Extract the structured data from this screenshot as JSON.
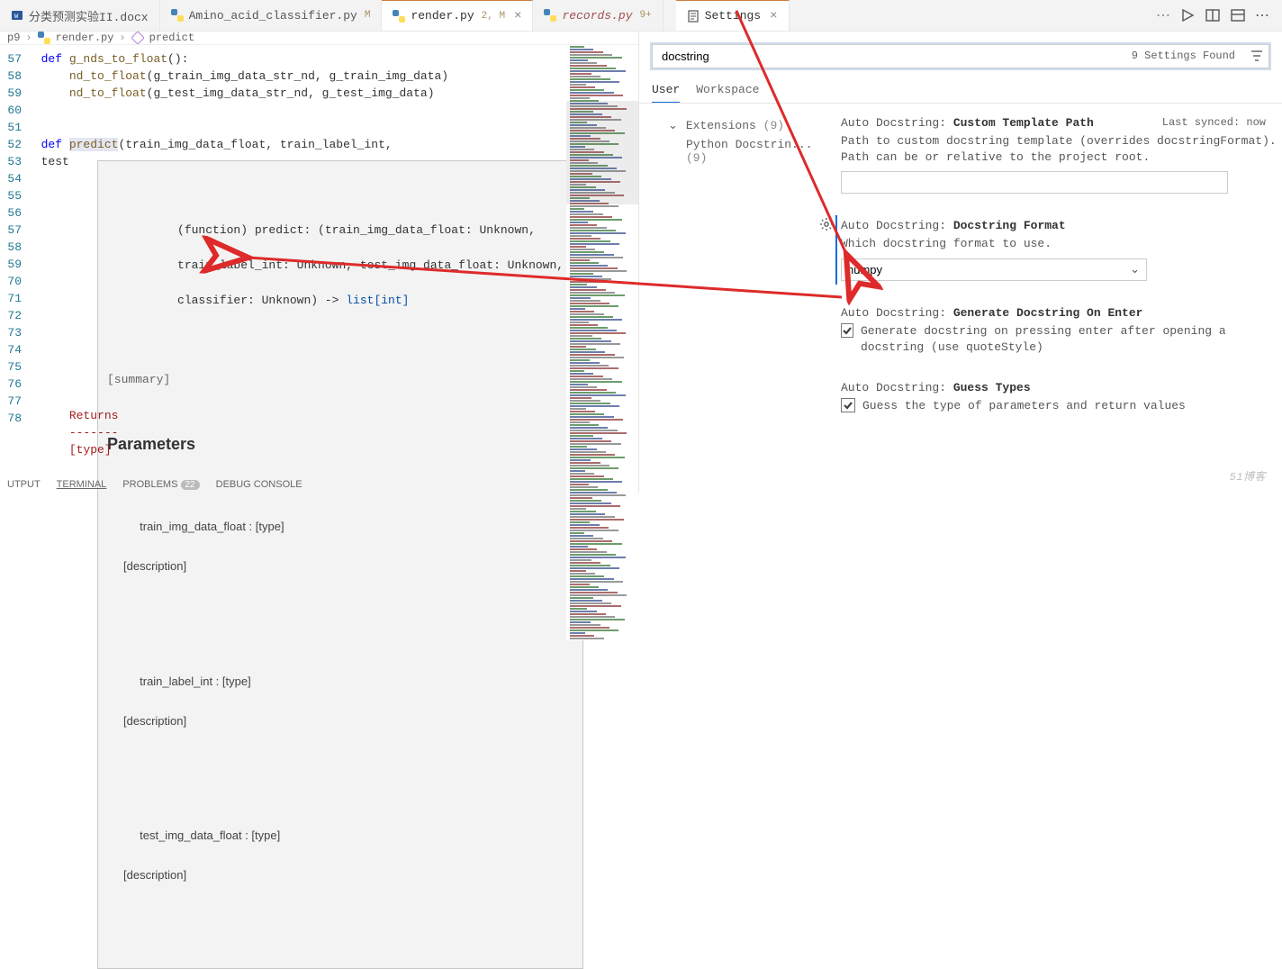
{
  "tabs": {
    "t0": "分类预测实验II.docx",
    "t1": "Amino_acid_classifier.py",
    "t1_badge": "M",
    "t2": "render.py",
    "t2_badge": "2, M",
    "t3": "records.py",
    "t3_badge": "9+",
    "t4": "Settings"
  },
  "breadcrumb": {
    "p1": "p9",
    "p2": "render.py",
    "p3": "predict"
  },
  "gutter": [
    "57",
    "58",
    "59",
    "60",
    "51",
    "52",
    "53",
    "54",
    "55",
    "56",
    "57",
    "58",
    "59",
    "70",
    "71",
    "72",
    "73",
    "74",
    "75",
    "76",
    "77",
    "78"
  ],
  "hover": {
    "sig1": "(function) predict: (train_img_data_float: Unknown,",
    "sig2": "train_label_int: Unknown, test_img_data_float: Unknown,",
    "sig3": "classifier: Unknown) -> ",
    "sig3_type": "list[int]",
    "summary": "[summary]",
    "params_h": "Parameters",
    "p1": "train_img_data_float : [type]",
    "p1d": "[description]",
    "p2": "train_label_int : [type]",
    "p2d": "[description]",
    "p3": "test_img_data_float : [type]",
    "p3d": "[description]"
  },
  "code_below": {
    "returns": "Returns",
    "dash": "-------",
    "type": "[type]"
  },
  "settings": {
    "title": "Settings",
    "search_value": "docstring",
    "found": "9 Settings Found",
    "scope_user": "User",
    "scope_ws": "Workspace",
    "last_synced": "Last synced: now",
    "toc_ext": "Extensions",
    "toc_ext_count": "(9)",
    "toc_sub": "Python Docstrin...",
    "toc_sub_count": "(9)",
    "s1_prefix": "Auto Docstring: ",
    "s1_name": "Custom Template Path",
    "s1_desc": "Path to custom docstring template (overrides docstringFormat). Path can be or relative to the project root.",
    "s2_prefix": "Auto Docstring: ",
    "s2_name": "Docstring Format",
    "s2_desc": "Which docstring format to use.",
    "s2_value": "numpy",
    "s3_prefix": "Auto Docstring: ",
    "s3_name": "Generate Docstring On Enter",
    "s3_desc": "Generate docstring on pressing enter after opening a docstring (use quoteStyle)",
    "s4_prefix": "Auto Docstring: ",
    "s4_name": "Guess Types",
    "s4_desc": "Guess the type of parameters and return values"
  },
  "bottom": {
    "output": "UTPUT",
    "terminal": "TERMINAL",
    "problems": "PROBLEMS",
    "problems_count": "22",
    "debug": "DEBUG CONSOLE"
  },
  "watermark": "51博客"
}
